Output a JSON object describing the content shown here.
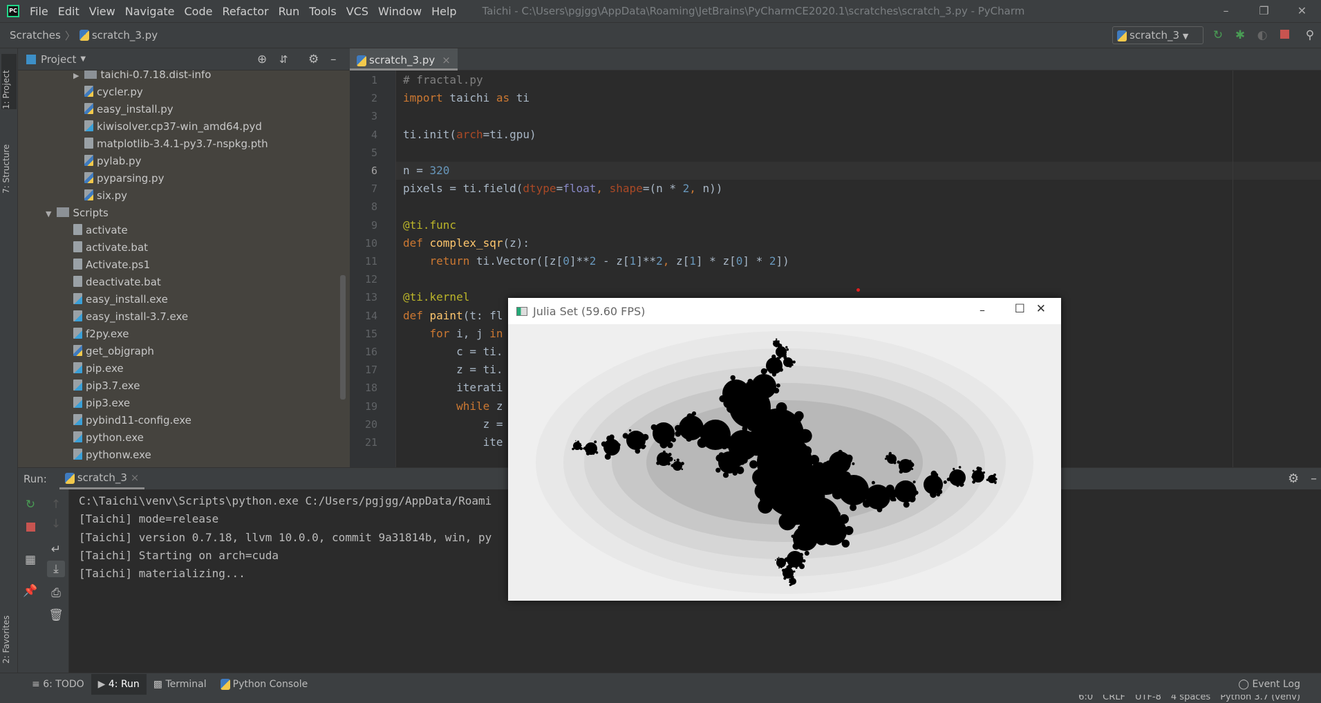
{
  "menubar": {
    "items": [
      "File",
      "Edit",
      "View",
      "Navigate",
      "Code",
      "Refactor",
      "Run",
      "Tools",
      "VCS",
      "Window",
      "Help"
    ],
    "window_title": "Taichi - C:\\Users\\pgjgg\\AppData\\Roaming\\JetBrains\\PyCharmCE2020.1\\scratches\\scratch_3.py - PyCharm",
    "logo": "PC"
  },
  "navbar": {
    "breadcrumb": [
      "Scratches",
      "scratch_3.py"
    ],
    "run_config": "scratch_3"
  },
  "left_stripe": {
    "tabs": [
      "1: Project",
      "7: Structure",
      "2: Favorites"
    ]
  },
  "project": {
    "title": "Project",
    "tree": [
      {
        "label": "taichi-0.7.18.dist-info",
        "type": "folder",
        "depth": 2,
        "expanded": false
      },
      {
        "label": "cycler.py",
        "type": "py",
        "depth": 3
      },
      {
        "label": "easy_install.py",
        "type": "py",
        "depth": 3
      },
      {
        "label": "kiwisolver.cp37-win_amd64.pyd",
        "type": "unk",
        "depth": 3
      },
      {
        "label": "matplotlib-3.4.1-py3.7-nspkg.pth",
        "type": "text",
        "depth": 3
      },
      {
        "label": "pylab.py",
        "type": "py",
        "depth": 3
      },
      {
        "label": "pyparsing.py",
        "type": "py",
        "depth": 3
      },
      {
        "label": "six.py",
        "type": "py",
        "depth": 3
      },
      {
        "label": "Scripts",
        "type": "folder",
        "depth": 1,
        "expanded": true
      },
      {
        "label": "activate",
        "type": "text",
        "depth": 2
      },
      {
        "label": "activate.bat",
        "type": "text",
        "depth": 2
      },
      {
        "label": "Activate.ps1",
        "type": "text",
        "depth": 2
      },
      {
        "label": "deactivate.bat",
        "type": "text",
        "depth": 2
      },
      {
        "label": "easy_install.exe",
        "type": "unk",
        "depth": 2
      },
      {
        "label": "easy_install-3.7.exe",
        "type": "unk",
        "depth": 2
      },
      {
        "label": "f2py.exe",
        "type": "unk",
        "depth": 2
      },
      {
        "label": "get_objgraph",
        "type": "py",
        "depth": 2
      },
      {
        "label": "pip.exe",
        "type": "unk",
        "depth": 2
      },
      {
        "label": "pip3.7.exe",
        "type": "unk",
        "depth": 2
      },
      {
        "label": "pip3.exe",
        "type": "unk",
        "depth": 2
      },
      {
        "label": "pybind11-config.exe",
        "type": "unk",
        "depth": 2
      },
      {
        "label": "python.exe",
        "type": "unk",
        "depth": 2
      },
      {
        "label": "pythonw.exe",
        "type": "unk",
        "depth": 2
      }
    ]
  },
  "editor": {
    "tab": "scratch_3.py",
    "current_line": 6,
    "lines": [
      [
        [
          "# fractal.py",
          "cm"
        ]
      ],
      [
        [
          "import",
          "kw"
        ],
        [
          " taichi ",
          ""
        ],
        [
          "as",
          "kw"
        ],
        [
          " ti",
          ""
        ]
      ],
      [],
      [
        [
          "ti.init(",
          ""
        ],
        [
          "arch",
          "par"
        ],
        [
          "=ti.gpu)",
          ""
        ]
      ],
      [],
      [
        [
          "n = ",
          ""
        ],
        [
          "320",
          "num"
        ]
      ],
      [
        [
          "pixels = ti.field(",
          ""
        ],
        [
          "dtype",
          "par"
        ],
        [
          "=",
          ""
        ],
        [
          "float",
          "bi"
        ],
        [
          ", ",
          "kw"
        ],
        [
          "shape",
          "par"
        ],
        [
          "=(n * ",
          ""
        ],
        [
          "2",
          "num"
        ],
        [
          ", ",
          "kw"
        ],
        [
          "n))",
          ""
        ]
      ],
      [],
      [
        [
          "@ti.func",
          "dec"
        ]
      ],
      [
        [
          "def ",
          "kw"
        ],
        [
          "complex_sqr",
          "fn"
        ],
        [
          "(z):",
          ""
        ]
      ],
      [
        [
          "    ",
          ""
        ],
        [
          "return",
          "kw"
        ],
        [
          " ti.Vector([z[",
          ""
        ],
        [
          "0",
          "num"
        ],
        [
          "]**",
          ""
        ],
        [
          "2",
          "num"
        ],
        [
          " - z[",
          ""
        ],
        [
          "1",
          "num"
        ],
        [
          "]**",
          ""
        ],
        [
          "2",
          "num"
        ],
        [
          ", ",
          "kw"
        ],
        [
          "z[",
          ""
        ],
        [
          "1",
          "num"
        ],
        [
          "] * z[",
          ""
        ],
        [
          "0",
          "num"
        ],
        [
          "] * ",
          ""
        ],
        [
          "2",
          "num"
        ],
        [
          "])",
          ""
        ]
      ],
      [],
      [
        [
          "@ti.kernel",
          "dec"
        ]
      ],
      [
        [
          "def ",
          "kw"
        ],
        [
          "paint",
          "fn"
        ],
        [
          "(t: fl",
          ""
        ]
      ],
      [
        [
          "    ",
          ""
        ],
        [
          "for",
          "kw"
        ],
        [
          " i, j ",
          ""
        ],
        [
          "in",
          "kw"
        ]
      ],
      [
        [
          "        c = ti.",
          ""
        ]
      ],
      [
        [
          "        z = ti.",
          ""
        ]
      ],
      [
        [
          "        iterati",
          ""
        ]
      ],
      [
        [
          "        ",
          ""
        ],
        [
          "while",
          "kw"
        ],
        [
          " z",
          ""
        ]
      ],
      [
        [
          "            z =",
          ""
        ]
      ],
      [
        [
          "            ite",
          ""
        ]
      ]
    ]
  },
  "run": {
    "label": "Run:",
    "tab": "scratch_3",
    "output": [
      "C:\\Taichi\\venv\\Scripts\\python.exe C:/Users/pgjgg/AppData/Roami",
      "[Taichi] mode=release",
      "[Taichi] version 0.7.18, llvm 10.0.0, commit 9a31814b, win, py",
      "[Taichi] Starting on arch=cuda",
      "[Taichi] materializing..."
    ]
  },
  "bottom_tabs": {
    "todo": "6: TODO",
    "run": "4: Run",
    "terminal": "Terminal",
    "console": "Python Console",
    "event_log": "Event Log"
  },
  "status": {
    "position": "6:0",
    "line_sep": "CRLF",
    "encoding": "UTF-8",
    "indent": "4 spaces",
    "interpreter": "Python 3.7 (venv)"
  },
  "julia_window": {
    "title": "Julia Set (59.60 FPS)"
  },
  "colors": {
    "accent_run": "#499c54",
    "stop": "#c75450",
    "keyword": "#cc7832",
    "number": "#6897bb"
  }
}
